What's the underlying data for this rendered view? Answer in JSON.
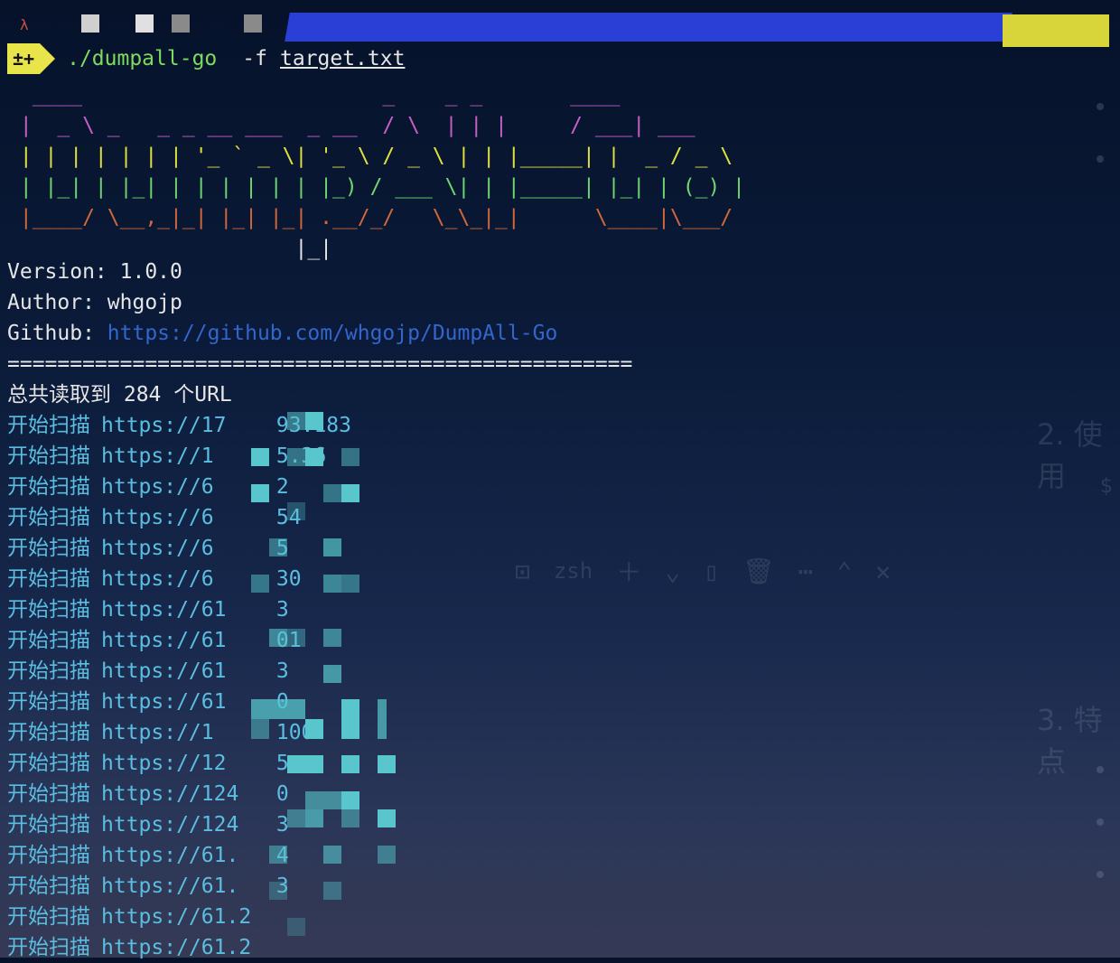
{
  "prompt": {
    "badge": "±+",
    "command": "./dumpall-go",
    "flag": "-f",
    "file": "target.txt"
  },
  "banner": [
    "  ____                        _    _ _       ____",
    " |  _ \\ _   _ _ __ ___  _ __  / \\  | | |     / ___| ___",
    " | | | | | | | '_ ` _ \\| '_ \\ / _ \\ | | |_____| |  _ / _ \\",
    " | |_| | |_| | | | | | | |_) / ___ \\| | |_____| |_| | (_) |",
    " |____/ \\__,_|_| |_| |_| .__/_/   \\_\\_|_|      \\____|\\___/",
    "                       |_|"
  ],
  "info": {
    "version_label": "Version:",
    "version": "1.0.0",
    "author_label": "Author:",
    "author": "whgojp",
    "github_label": "Github:",
    "github_url": "https://github.com/whgojp/DumpAll-Go",
    "separator": "==================================================",
    "summary": "总共读取到 284 个URL"
  },
  "scan": {
    "label": "开始扫描",
    "rows": [
      "https://17    93.183",
      "https://1     5.36",
      "https://6     2",
      "https://6     54",
      "https://6     5",
      "https://6     30",
      "https://61    3",
      "https://61    01",
      "https://61    3",
      "https://61    0",
      "https://1     100",
      "https://12    5",
      "https://124   0",
      "https://124   3",
      "https://61.   4",
      "https://61.   3",
      "https://61.2",
      "https://61.2"
    ]
  },
  "background": {
    "tab_label": "zsh",
    "heading_2": "2. 使用",
    "heading_3": "3. 特点",
    "dollar": "$"
  }
}
